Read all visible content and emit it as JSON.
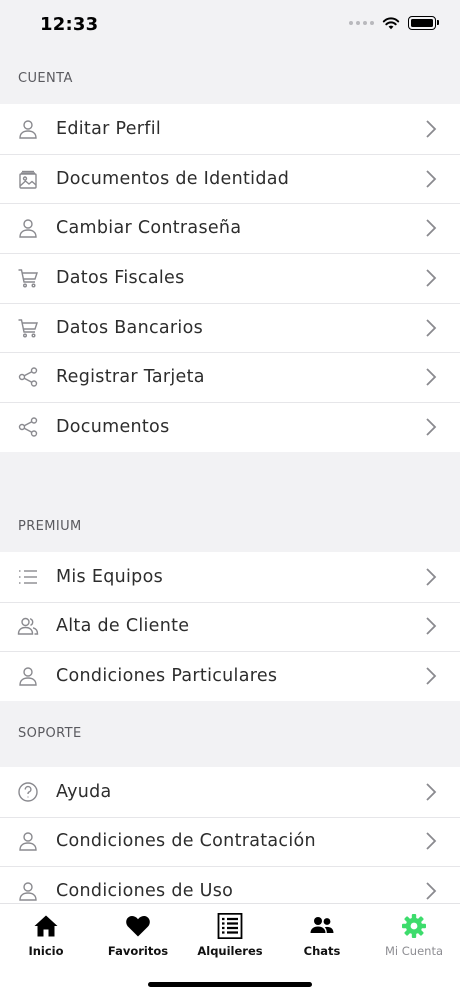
{
  "status": {
    "time": "12:33"
  },
  "sections": {
    "cuenta": {
      "title": "CUENTA",
      "items": [
        {
          "label": "Editar Perfil",
          "icon": "user-icon"
        },
        {
          "label": "Documentos de Identidad",
          "icon": "image-stack-icon"
        },
        {
          "label": "Cambiar Contraseña",
          "icon": "user-icon"
        },
        {
          "label": "Datos Fiscales",
          "icon": "cart-icon"
        },
        {
          "label": "Datos Bancarios",
          "icon": "cart-icon"
        },
        {
          "label": "Registrar Tarjeta",
          "icon": "share-icon"
        },
        {
          "label": "Documentos",
          "icon": "share-icon"
        }
      ]
    },
    "premium": {
      "title": "PREMIUM",
      "items": [
        {
          "label": "Mis Equipos",
          "icon": "list-icon"
        },
        {
          "label": "Alta de Cliente",
          "icon": "users-icon"
        },
        {
          "label": "Condiciones Particulares",
          "icon": "user-icon"
        }
      ]
    },
    "soporte": {
      "title": "SOPORTE",
      "items": [
        {
          "label": "Ayuda",
          "icon": "help-circle-icon"
        },
        {
          "label": "Condiciones de Contratación",
          "icon": "user-icon"
        },
        {
          "label": "Condiciones de Uso",
          "icon": "user-icon"
        }
      ]
    }
  },
  "tabbar": {
    "items": [
      {
        "label": "Inicio",
        "icon": "home-icon"
      },
      {
        "label": "Favoritos",
        "icon": "heart-icon"
      },
      {
        "label": "Alquileres",
        "icon": "list-document-icon"
      },
      {
        "label": "Chats",
        "icon": "people-icon"
      },
      {
        "label": "Mi Cuenta",
        "icon": "gear-icon",
        "active": true
      }
    ],
    "active_color": "#3ddc6c"
  }
}
